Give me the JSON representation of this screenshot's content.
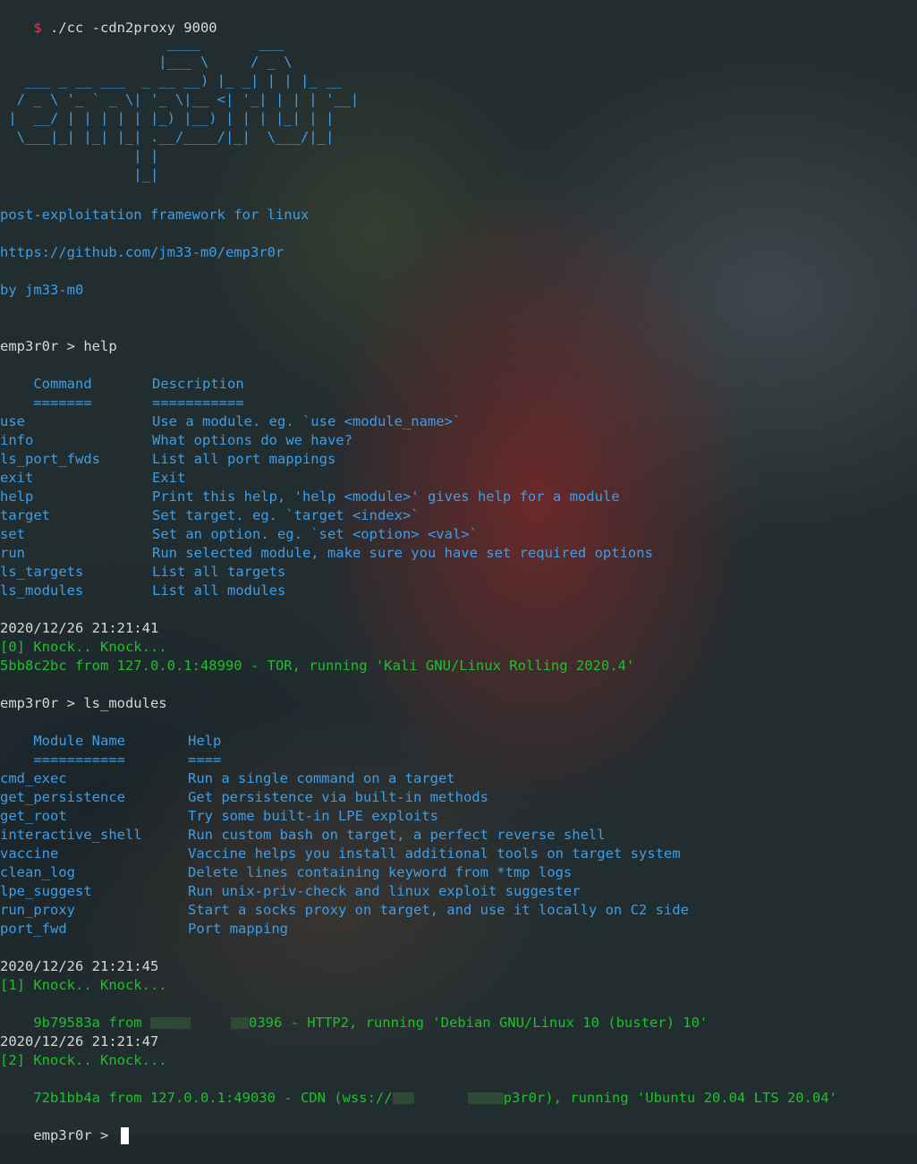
{
  "command": {
    "prompt": "$",
    "text": " ./cc -cdn2proxy 9000"
  },
  "banner": {
    "art": "                    ____       ___\n                   |___ \\     / _ \\\n   ___ _ __ ___  _ __ __) |_ _| | | |_ __\n  / _ \\ '_ ` _ \\| '_ \\|__ <| '_| | | | '__|\n |  __/ | | | | | |_) |__) | | | |_| | |\n  \\___|_| |_| |_| .__/____/|_|  \\___/|_|\n                | |\n                |_|",
    "tagline": "post-exploitation framework for linux",
    "url": "https://github.com/jm33-m0/emp3r0r",
    "author": "by jm33-m0"
  },
  "help_section": {
    "prompt": "emp3r0r > help",
    "headers": [
      "Command",
      "Description"
    ],
    "underline": [
      "=======",
      "==========="
    ],
    "rows": [
      [
        "use",
        "Use a module. eg. `use <module_name>`"
      ],
      [
        "info",
        "What options do we have?"
      ],
      [
        "ls_port_fwds",
        "List all port mappings"
      ],
      [
        "exit",
        "Exit"
      ],
      [
        "help",
        "Print this help, 'help <module>' gives help for a module"
      ],
      [
        "target",
        "Set target. eg. `target <index>`"
      ],
      [
        "set",
        "Set an option. eg. `set <option> <val>`"
      ],
      [
        "run",
        "Run selected module, make sure you have set required options"
      ],
      [
        "ls_targets",
        "List all targets"
      ],
      [
        "ls_modules",
        "List all modules"
      ]
    ]
  },
  "event1": {
    "timestamp": "2020/12/26 21:21:41",
    "knock": "[0] Knock.. Knock...",
    "detail": "5bb8c2bc from 127.0.0.1:48990 - TOR, running 'Kali GNU/Linux Rolling 2020.4'"
  },
  "modules_section": {
    "prompt": "emp3r0r > ls_modules",
    "headers": [
      "Module Name",
      "Help"
    ],
    "underline": [
      "===========",
      "===="
    ],
    "rows": [
      [
        "cmd_exec",
        "Run a single command on a target"
      ],
      [
        "get_persistence",
        "Get persistence via built-in methods"
      ],
      [
        "get_root",
        "Try some built-in LPE exploits"
      ],
      [
        "interactive_shell",
        "Run custom bash on target, a perfect reverse shell"
      ],
      [
        "vaccine",
        "Vaccine helps you install additional tools on target system"
      ],
      [
        "clean_log",
        "Delete lines containing keyword from *tmp logs"
      ],
      [
        "lpe_suggest",
        "Run unix-priv-check and linux exploit suggester"
      ],
      [
        "run_proxy",
        "Start a socks proxy on target, and use it locally on C2 side"
      ],
      [
        "port_fwd",
        "Port mapping"
      ]
    ]
  },
  "event2": {
    "timestamp": "2020/12/26 21:21:45",
    "knock": "[1] Knock.. Knock...",
    "detail_prefix": "9b79583a from ",
    "detail_suffix": "0396 - HTTP2, running 'Debian GNU/Linux 10 (buster) 10'"
  },
  "event3": {
    "timestamp": "2020/12/26 21:21:47",
    "knock": "[2] Knock.. Knock...",
    "detail_prefix": "72b1bb4a from 127.0.0.1:49030 - CDN (wss://",
    "detail_suffix": "p3r0r), running 'Ubuntu 20.04 LTS 20.04'"
  },
  "final_prompt": "emp3r0r > ",
  "colors": {
    "prompt_red": "#e8334a",
    "text_white": "#d8d8d8",
    "text_blue": "#3d9ee8",
    "text_green": "#1dc12a"
  }
}
